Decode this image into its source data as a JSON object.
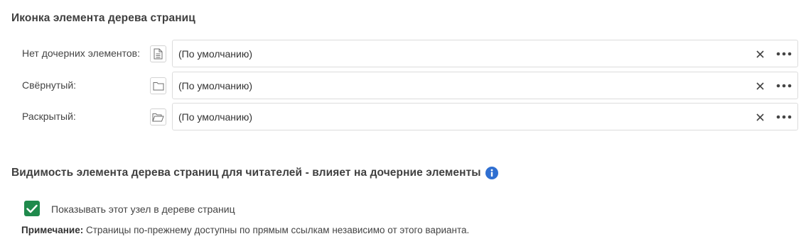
{
  "section1": {
    "title": "Иконка элемента дерева страниц",
    "rows": [
      {
        "label": "Нет дочерних элементов:",
        "icon": "document-icon",
        "value": "(По умолчанию)"
      },
      {
        "label": "Свёрнутый:",
        "icon": "folder-closed-icon",
        "value": "(По умолчанию)"
      },
      {
        "label": "Раскрытый:",
        "icon": "folder-open-icon",
        "value": "(По умолчанию)"
      }
    ]
  },
  "section2": {
    "title": "Видимость элемента дерева страниц для читателей - влияет на дочерние элементы",
    "checkbox_label": "Показывать этот узел в дереве страниц",
    "checkbox_checked": true,
    "note_label": "Примечание:",
    "note_text": " Страницы по-прежнему доступны по прямым ссылкам независимо от этого варианта."
  },
  "colors": {
    "accent_green": "#1f8a4c",
    "info_blue": "#2f6fd1"
  }
}
